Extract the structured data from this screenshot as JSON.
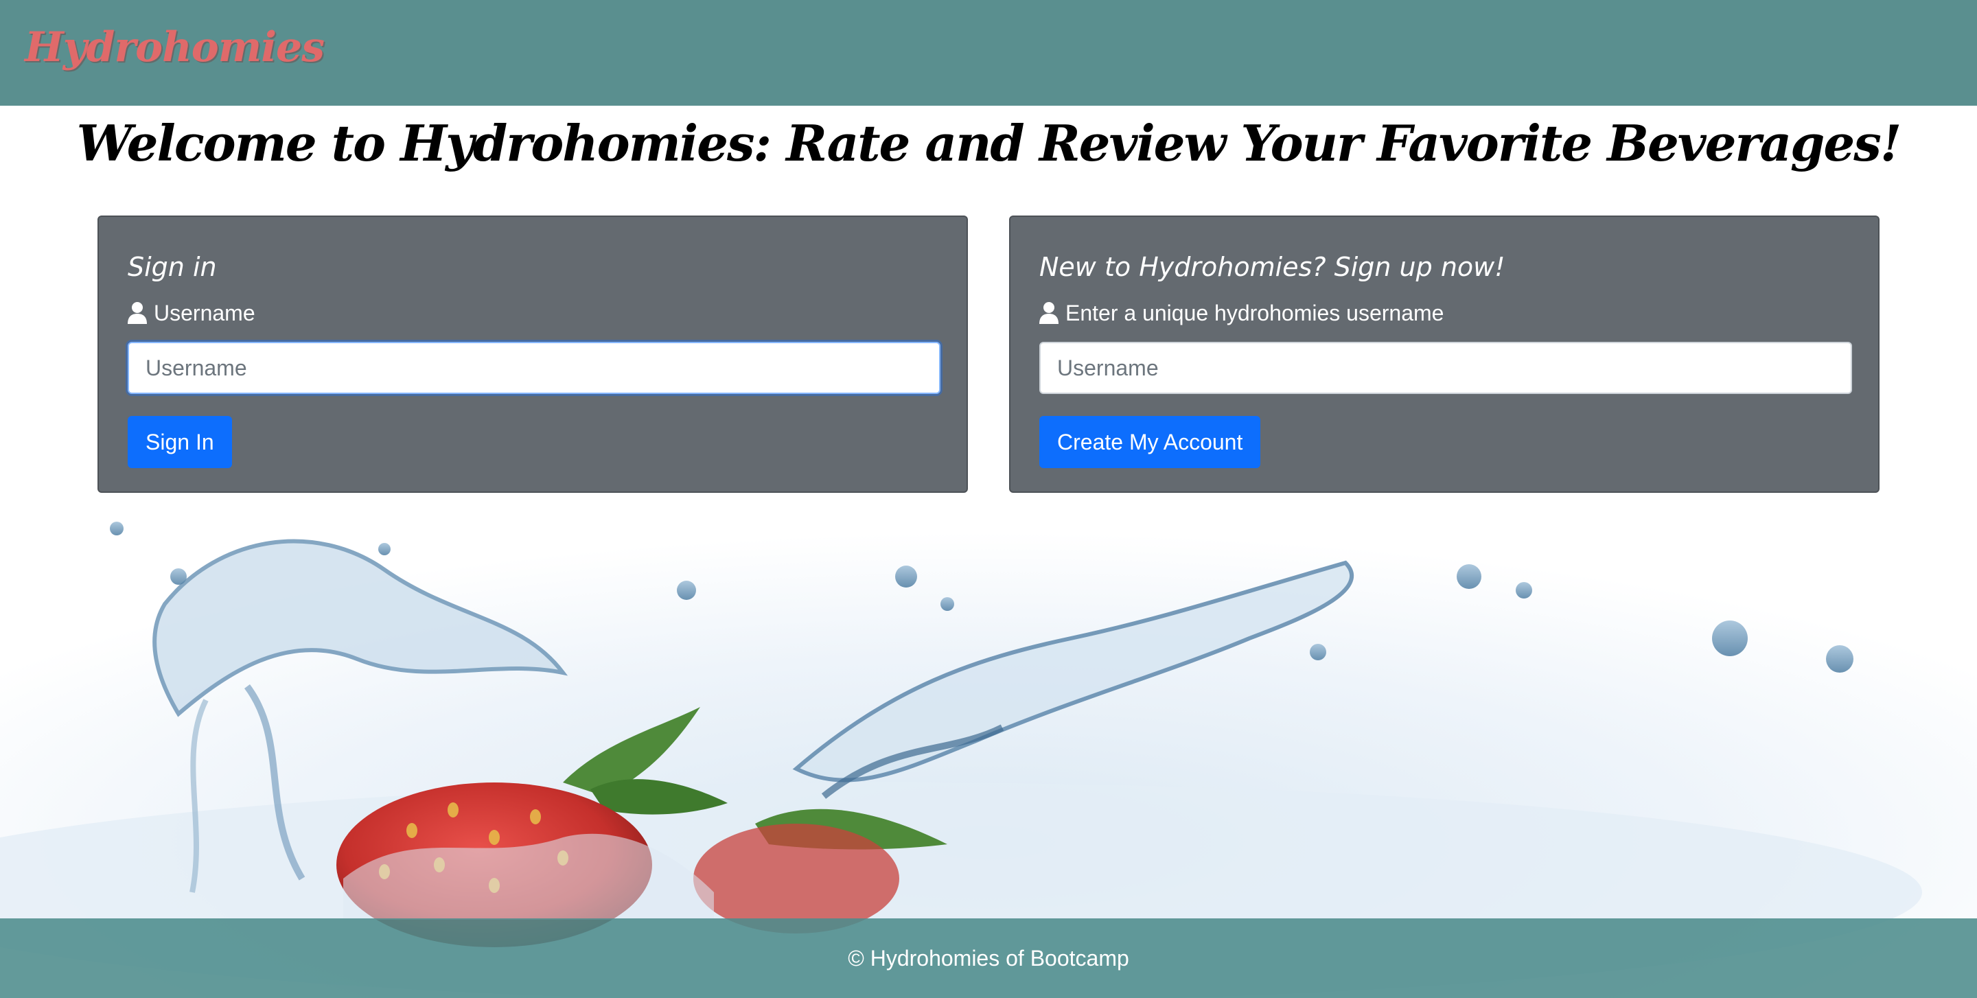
{
  "navbar": {
    "brand": "Hydrohomies"
  },
  "main": {
    "title": "Welcome to Hydrohomies: Rate and Review Your Favorite Beverages!"
  },
  "signin": {
    "title": "Sign in",
    "label": "Username",
    "placeholder": "Username",
    "button": "Sign In"
  },
  "signup": {
    "title": "New to Hydrohomies? Sign up now!",
    "label": "Enter a unique hydrohomies username",
    "placeholder": "Username",
    "button": "Create My Account"
  },
  "footer": {
    "text": "© Hydrohomies of Bootcamp"
  },
  "icons": {
    "label_icon": "user-icon"
  },
  "colors": {
    "navbar": "#5a8f8f",
    "brand": "#e06a6a",
    "card": "#646a70",
    "primary_button": "#0d6efd",
    "footer": "#4d8c8c"
  }
}
